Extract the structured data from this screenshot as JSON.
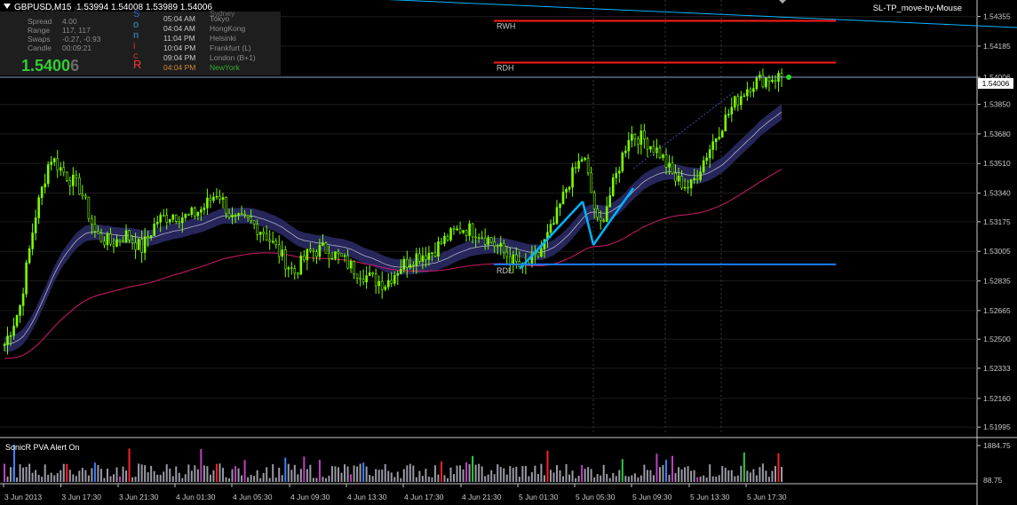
{
  "header": {
    "symbol": "GBPUSD,M15",
    "ohlc": "1.53994 1.54008 1.53989 1.54006",
    "ea_name": "SL-TP_move-by-Mouse",
    "watermark": "GBPUSD M15"
  },
  "info": {
    "labels": [
      "Spread",
      "Range",
      "Swaps",
      "Candle"
    ],
    "values": [
      "4.00",
      "117, 117",
      "-0.27, -0.93",
      "00:09:21"
    ],
    "price_main": "1.5400",
    "price_last": "6",
    "letters": [
      "S",
      "o",
      "n",
      "i",
      "c",
      "R"
    ],
    "letter_colors": [
      "#3366cc",
      "#3399cc",
      "#3399cc",
      "#cc3333",
      "#cc3333",
      "#ff3333"
    ],
    "sessions": [
      {
        "time": "",
        "name": "Sydney",
        "color": "#6a6a6a"
      },
      {
        "time": "05:04 AM",
        "name": "Tokyo",
        "color": "#8a8a8a"
      },
      {
        "time": "04:04 AM",
        "name": "HongKong",
        "color": "#8a8a8a"
      },
      {
        "time": "11:04 PM",
        "name": "Helsinki",
        "color": "#8a8a8a"
      },
      {
        "time": "10:04 PM",
        "name": "Frankfurt  (L)",
        "color": "#8a8a8a"
      },
      {
        "time": "09:04 PM",
        "name": "London  (B+1)",
        "color": "#8a8a8a"
      },
      {
        "time": "04:04 PM",
        "name": "NewYork",
        "color": "#33aa33"
      }
    ]
  },
  "levels": {
    "rwh": {
      "label": "RWH",
      "price": 1.5433,
      "color": "#ff1a1a"
    },
    "rdh": {
      "label": "RDH",
      "price": 1.5409,
      "color": "#ff1a1a"
    },
    "rdl": {
      "label": "RDL",
      "price": 1.5293,
      "color": "#1a7fff"
    },
    "current": {
      "price": 1.54006,
      "label": "1.54006"
    }
  },
  "price_axis": {
    "ticks": [
      "1.54355",
      "1.54185",
      "1.54006",
      "1.53850",
      "1.53680",
      "1.53510",
      "1.53340",
      "1.53175",
      "1.53005",
      "1.52835",
      "1.52665",
      "1.52500",
      "1.52333",
      "1.52160",
      "1.51995"
    ],
    "tick_values": [
      1.54355,
      1.54185,
      1.54006,
      1.5385,
      1.5368,
      1.5351,
      1.5334,
      1.53175,
      1.53005,
      1.52835,
      1.52665,
      1.525,
      1.52333,
      1.5216,
      1.51995
    ]
  },
  "time_axis": {
    "labels": [
      "3 Jun 2013",
      "3 Jun 17:30",
      "3 Jun 21:30",
      "4 Jun 01:30",
      "4 Jun 05:30",
      "4 Jun 09:30",
      "4 Jun 13:30",
      "4 Jun 17:30",
      "4 Jun 21:30",
      "5 Jun 01:30",
      "5 Jun 05:30",
      "5 Jun 09:30",
      "5 Jun 13:30",
      "5 Jun 17:30"
    ]
  },
  "sub_window": {
    "title": "SonicR PVA   Alert On",
    "max_label": "1884.75",
    "min_label": "88.75"
  },
  "colors": {
    "candle": "#7cfc00",
    "band": "#282860",
    "ema_slow": "#d01a6a",
    "trend": "#00b4ff",
    "grid": "#1c1c1c",
    "vol_normal": "#9a9aa6",
    "vol_up": "#2ecc40",
    "vol_down": "#ff2020",
    "vol_climax": "#3d7fff",
    "vol_rising": "#c040c0"
  },
  "chart_data": {
    "type": "candlestick",
    "anchors_close": [
      1.5247,
      1.5268,
      1.532,
      1.5355,
      1.5345,
      1.5336,
      1.531,
      1.5305,
      1.531,
      1.5302,
      1.5318,
      1.5322,
      1.532,
      1.5325,
      1.5335,
      1.5318,
      1.5318,
      1.5312,
      1.53,
      1.5288,
      1.53,
      1.5302,
      1.5297,
      1.529,
      1.5285,
      1.5282,
      1.5292,
      1.5298,
      1.53,
      1.5308,
      1.5314,
      1.5312,
      1.5306,
      1.5298,
      1.529,
      1.5298,
      1.5315,
      1.534,
      1.5356,
      1.5313,
      1.534,
      1.5368,
      1.5365,
      1.5357,
      1.5342,
      1.5337,
      1.5355,
      1.5372,
      1.5387,
      1.5397,
      1.54,
      1.5401
    ],
    "current_price": 1.54006
  }
}
